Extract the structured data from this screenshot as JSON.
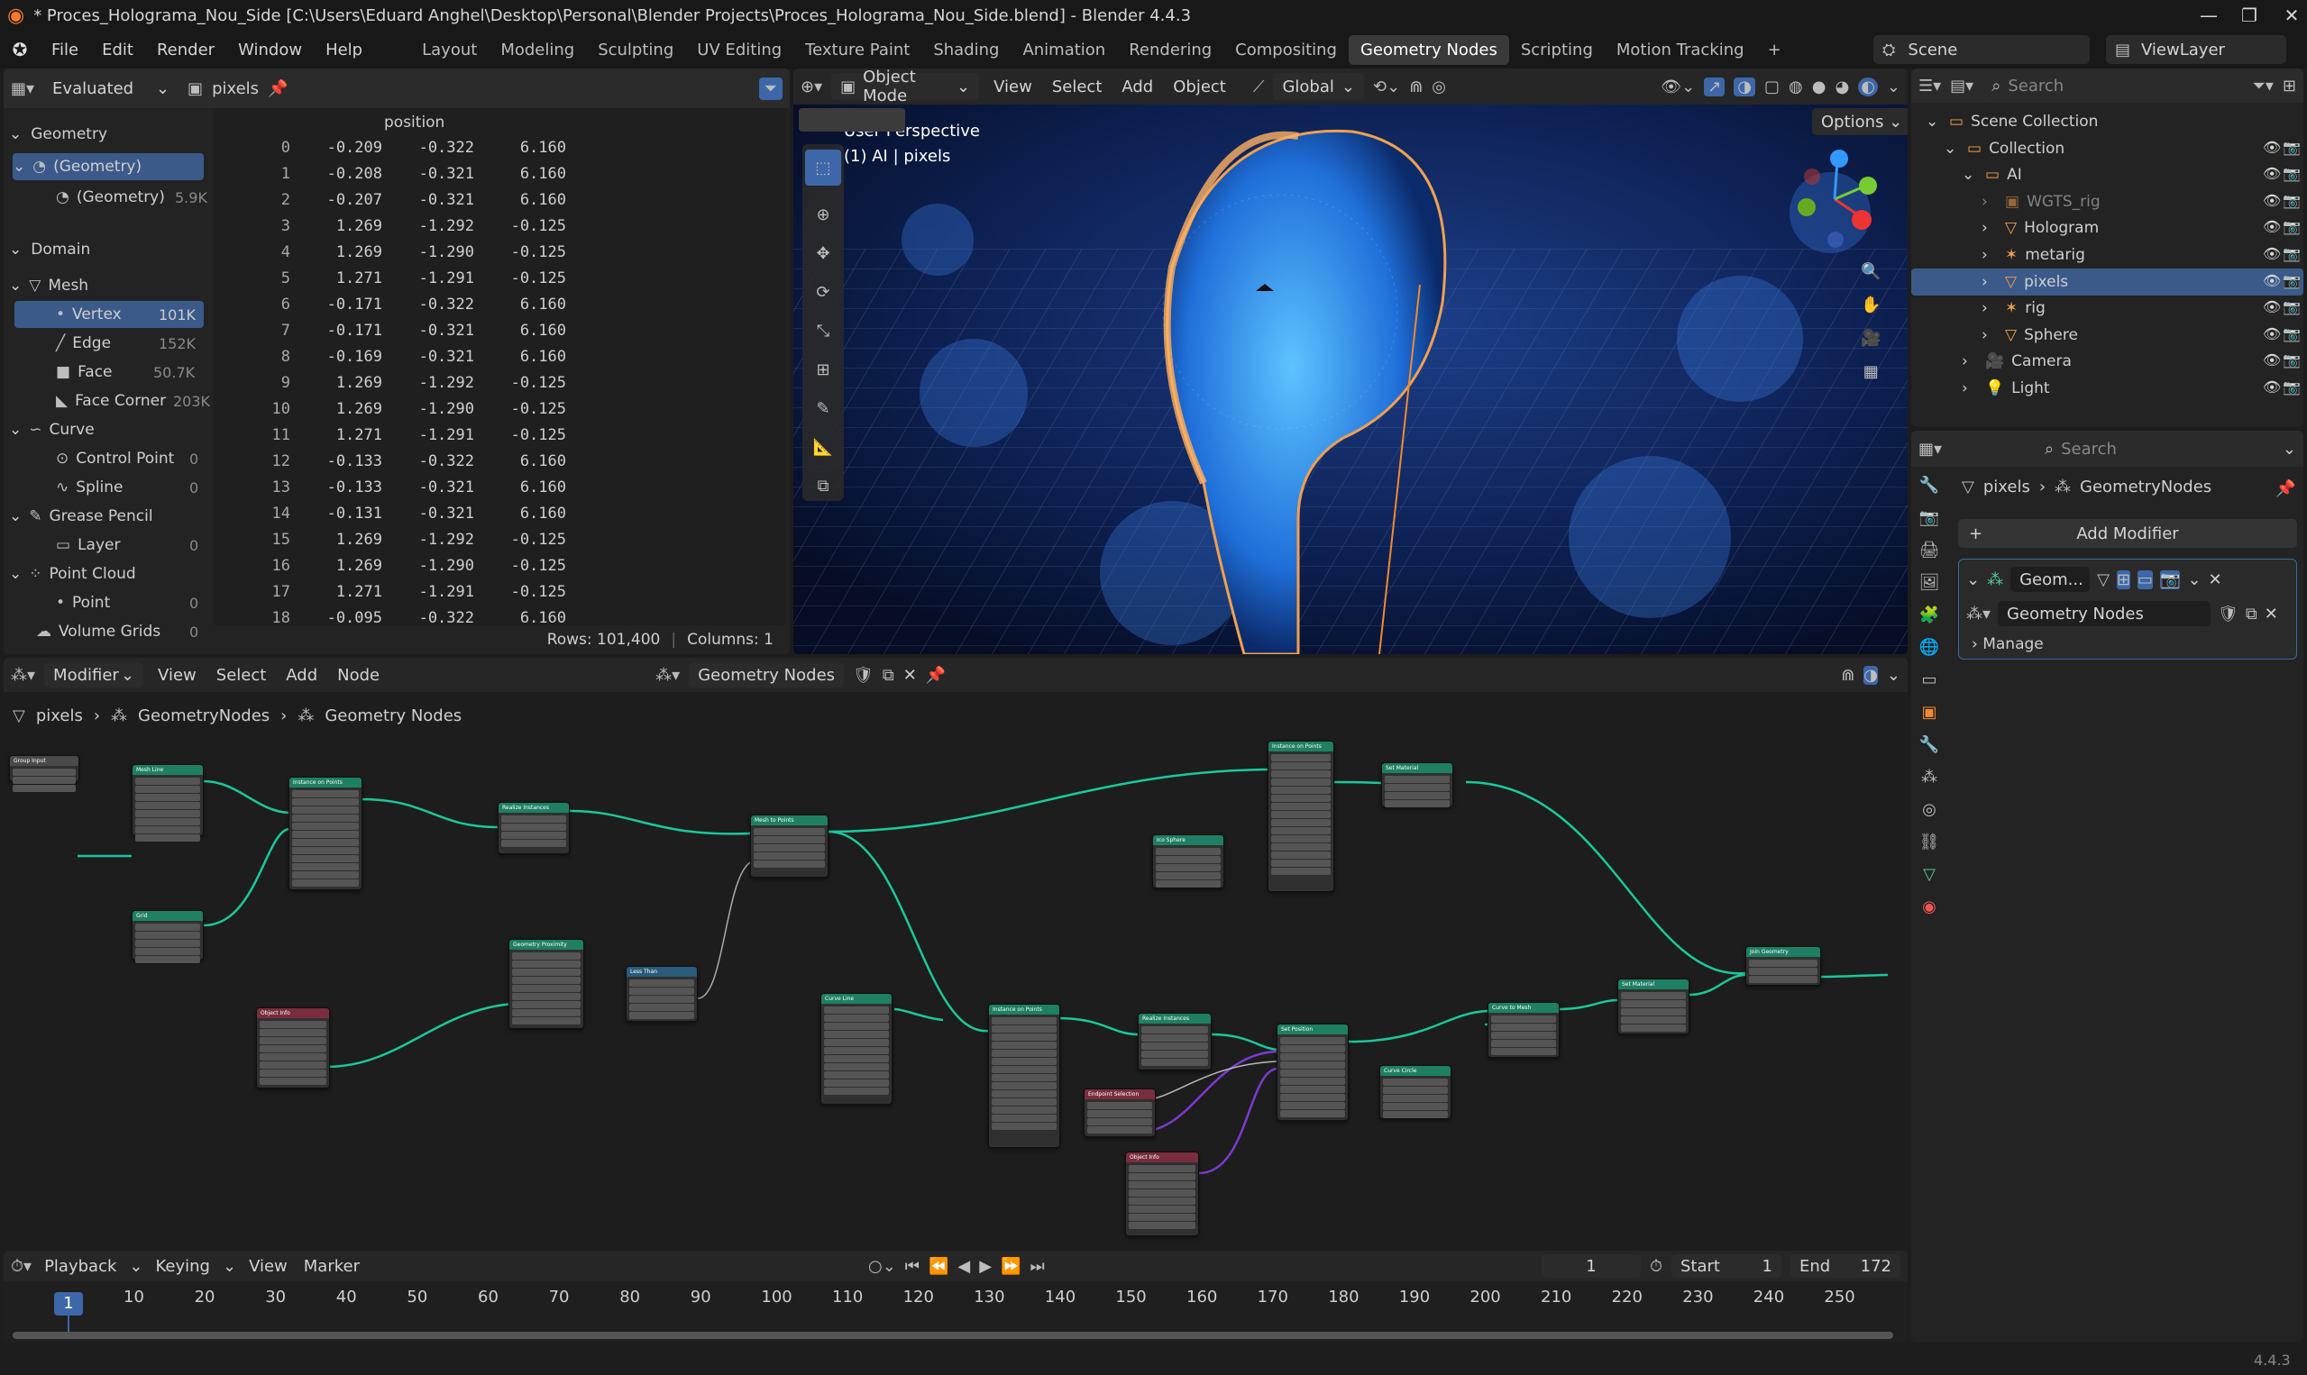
{
  "window": {
    "title": "* Proces_Holograma_Nou_Side [C:\\Users\\Eduard Anghel\\Desktop\\Personal\\Blender Projects\\Proces_Holograma_Nou_Side.blend] - Blender 4.4.3"
  },
  "menu": [
    "File",
    "Edit",
    "Render",
    "Window",
    "Help"
  ],
  "workspaces": [
    "Layout",
    "Modeling",
    "Sculpting",
    "UV Editing",
    "Texture Paint",
    "Shading",
    "Animation",
    "Rendering",
    "Compositing",
    "Geometry Nodes",
    "Scripting",
    "Motion Tracking"
  ],
  "active_workspace": "Geometry Nodes",
  "scene": "Scene",
  "view_layer": "ViewLayer",
  "spreadsheet": {
    "mode": "Evaluated",
    "object": "pixels",
    "column_header": "position",
    "rows_label": "Rows: 101,400",
    "cols_label": "Columns: 1",
    "tree": [
      {
        "label": "Geometry",
        "count": ""
      },
      {
        "label": "(Geometry)",
        "count": ""
      },
      {
        "label": "(Geometry)",
        "count": "5.9K"
      },
      {
        "label": "Domain",
        "count": ""
      },
      {
        "label": "Mesh",
        "count": ""
      },
      {
        "label": "Vertex",
        "count": "101K"
      },
      {
        "label": "Edge",
        "count": "152K"
      },
      {
        "label": "Face",
        "count": "50.7K"
      },
      {
        "label": "Face Corner",
        "count": "203K"
      },
      {
        "label": "Curve",
        "count": ""
      },
      {
        "label": "Control Point",
        "count": "0"
      },
      {
        "label": "Spline",
        "count": "0"
      },
      {
        "label": "Grease Pencil",
        "count": ""
      },
      {
        "label": "Layer",
        "count": "0"
      },
      {
        "label": "Point Cloud",
        "count": ""
      },
      {
        "label": "Point",
        "count": "0"
      },
      {
        "label": "Volume Grids",
        "count": "0"
      }
    ],
    "rows": [
      [
        "0",
        "-0.209",
        "-0.322",
        "6.160"
      ],
      [
        "1",
        "-0.208",
        "-0.321",
        "6.160"
      ],
      [
        "2",
        "-0.207",
        "-0.321",
        "6.160"
      ],
      [
        "3",
        "1.269",
        "-1.292",
        "-0.125"
      ],
      [
        "4",
        "1.269",
        "-1.290",
        "-0.125"
      ],
      [
        "5",
        "1.271",
        "-1.291",
        "-0.125"
      ],
      [
        "6",
        "-0.171",
        "-0.322",
        "6.160"
      ],
      [
        "7",
        "-0.171",
        "-0.321",
        "6.160"
      ],
      [
        "8",
        "-0.169",
        "-0.321",
        "6.160"
      ],
      [
        "9",
        "1.269",
        "-1.292",
        "-0.125"
      ],
      [
        "10",
        "1.269",
        "-1.290",
        "-0.125"
      ],
      [
        "11",
        "1.271",
        "-1.291",
        "-0.125"
      ],
      [
        "12",
        "-0.133",
        "-0.322",
        "6.160"
      ],
      [
        "13",
        "-0.133",
        "-0.321",
        "6.160"
      ],
      [
        "14",
        "-0.131",
        "-0.321",
        "6.160"
      ],
      [
        "15",
        "1.269",
        "-1.292",
        "-0.125"
      ],
      [
        "16",
        "1.269",
        "-1.290",
        "-0.125"
      ],
      [
        "17",
        "1.271",
        "-1.291",
        "-0.125"
      ],
      [
        "18",
        "-0.095",
        "-0.322",
        "6.160"
      ]
    ]
  },
  "viewport": {
    "mode": "Object Mode",
    "menus": [
      "View",
      "Select",
      "Add",
      "Object"
    ],
    "orientation": "Global",
    "options": "Options",
    "perspective": "User Perspective",
    "info": "(1) AI | pixels"
  },
  "outliner": {
    "search": "Search",
    "rows": [
      {
        "label": "Scene Collection"
      },
      {
        "label": "Collection"
      },
      {
        "label": "AI"
      },
      {
        "label": "WGTS_rig"
      },
      {
        "label": "Hologram"
      },
      {
        "label": "metarig"
      },
      {
        "label": "pixels"
      },
      {
        "label": "rig"
      },
      {
        "label": "Sphere"
      },
      {
        "label": "Camera"
      },
      {
        "label": "Light"
      }
    ]
  },
  "properties": {
    "search": "Search",
    "breadcrumb_obj": "pixels",
    "breadcrumb_mod": "GeometryNodes",
    "add_modifier": "Add Modifier",
    "modifier_name": "Geom...",
    "node_group": "Geometry Nodes",
    "manage": "Manage"
  },
  "node_editor": {
    "type": "Modifier",
    "menus": [
      "View",
      "Select",
      "Add",
      "Node"
    ],
    "tree_name": "Geometry Nodes",
    "breadcrumb": [
      "pixels",
      "GeometryNodes",
      "Geometry Nodes"
    ],
    "nodes": [
      "Group Input",
      "Mesh Line",
      "Grid",
      "Instance on Points",
      "Realize Instances",
      "Mesh to Points",
      "Instance on Points",
      "Set Material",
      "Ico Sphere",
      "Geometry Proximity",
      "Less Than",
      "Object Info",
      "Curve Line",
      "Instance on Points",
      "Realize Instances",
      "Set Position",
      "Curve to Mesh",
      "Set Material",
      "Join Geometry",
      "Endpoint Selection",
      "Curve Circle",
      "Object Info"
    ]
  },
  "timeline": {
    "menus": [
      "Playback",
      "Keying",
      "View",
      "Marker"
    ],
    "current_frame": "1",
    "start_label": "Start",
    "start": "1",
    "end_label": "End",
    "end": "172",
    "ticks": [
      "1",
      "10",
      "20",
      "30",
      "40",
      "50",
      "60",
      "70",
      "80",
      "90",
      "100",
      "110",
      "120",
      "130",
      "140",
      "150",
      "160",
      "170",
      "180",
      "190",
      "200",
      "210",
      "220",
      "230",
      "240",
      "250"
    ]
  },
  "version": "4.4.3"
}
